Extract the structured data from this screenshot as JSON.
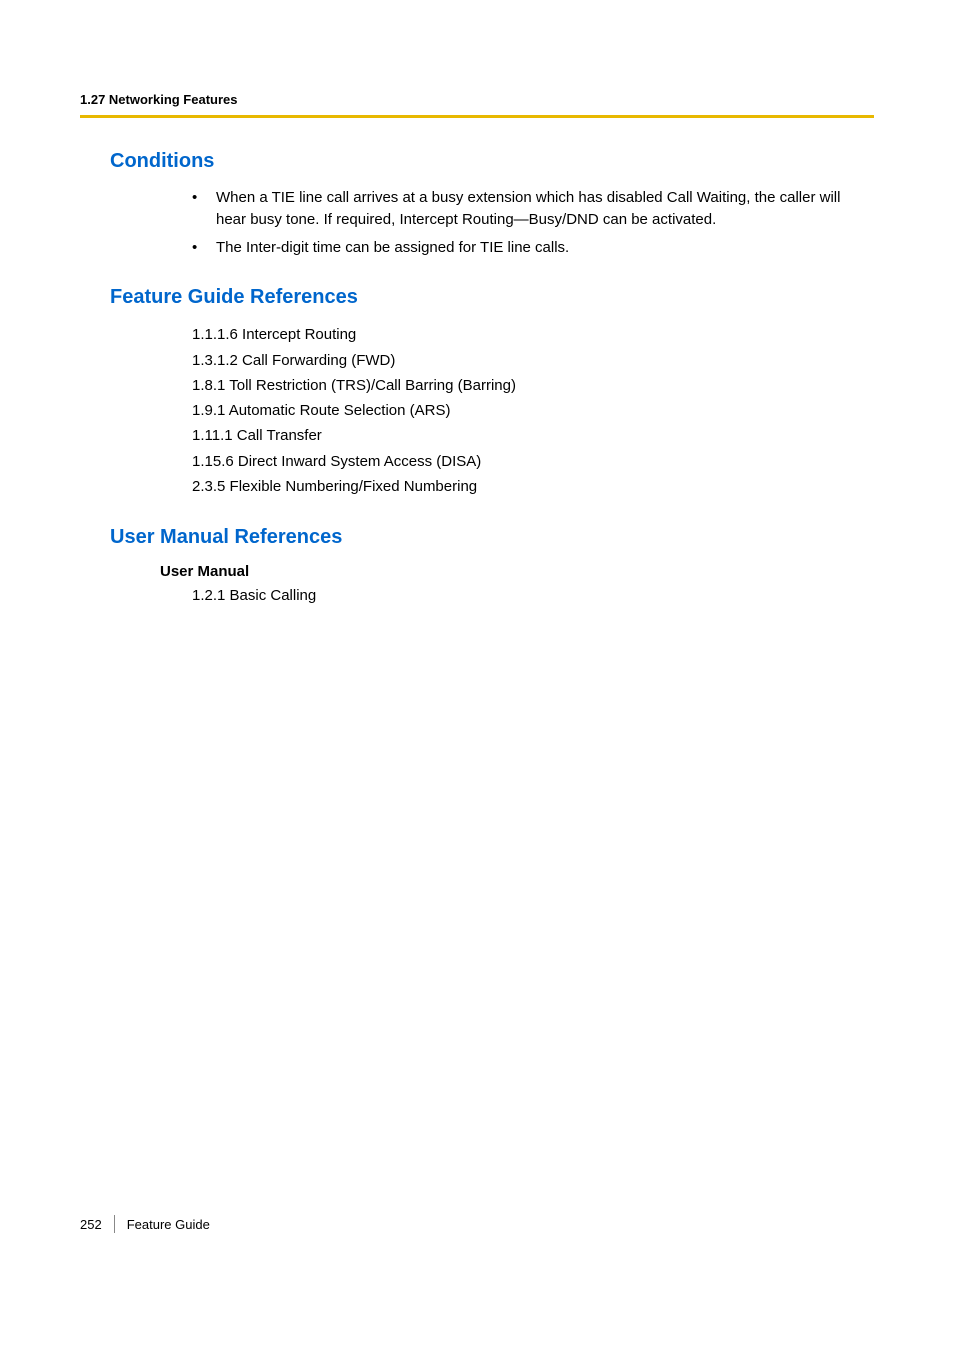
{
  "header": {
    "section": "1.27 Networking Features"
  },
  "sections": {
    "conditions": {
      "title": "Conditions",
      "bullets": [
        "When a TIE line call arrives at a busy extension which has disabled Call Waiting, the caller will hear busy tone. If required, Intercept Routing—Busy/DND can be activated.",
        "The Inter-digit time can be assigned for TIE line calls."
      ]
    },
    "featureGuideRefs": {
      "title": "Feature Guide References",
      "items": [
        "1.1.1.6 Intercept Routing",
        "1.3.1.2 Call Forwarding (FWD)",
        "1.8.1 Toll Restriction (TRS)/Call Barring (Barring)",
        "1.9.1 Automatic Route Selection (ARS)",
        "1.11.1 Call Transfer",
        "1.15.6 Direct Inward System Access (DISA)",
        "2.3.5 Flexible Numbering/Fixed Numbering"
      ]
    },
    "userManualRefs": {
      "title": "User Manual References",
      "subheading": "User Manual",
      "items": [
        "1.2.1 Basic Calling"
      ]
    }
  },
  "footer": {
    "pageNumber": "252",
    "docTitle": "Feature Guide"
  }
}
